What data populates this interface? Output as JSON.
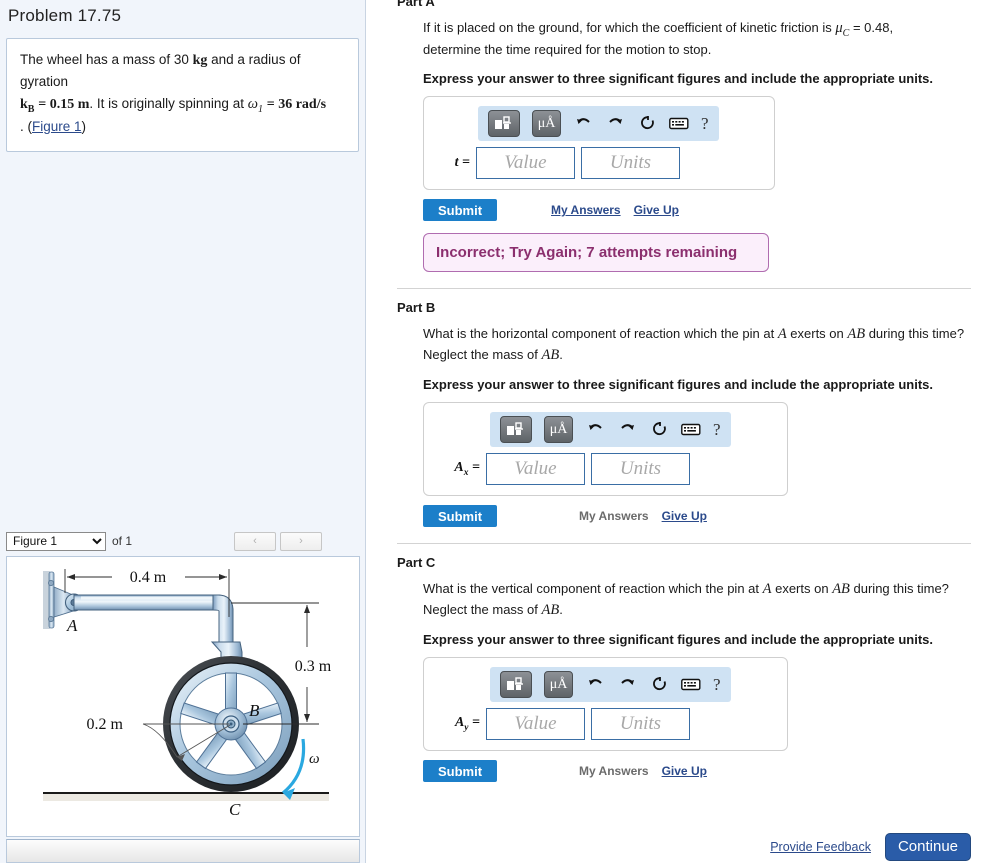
{
  "problem": {
    "title": "Problem 17.75",
    "statement_part1": "The wheel has a mass of 30 ",
    "mass_unit": "kg",
    "statement_part2": " and a radius of gyration",
    "kb_expr": "k",
    "kb_sub": "B",
    "kb_value": "= 0.15 m",
    "statement_part3": ". It is originally spinning at ",
    "omega_sym": "ω",
    "omega_sub": "1",
    "omega_value": "= 36 rad/s",
    "statement_part4": ".",
    "figure_link": "Figure 1"
  },
  "figure_nav": {
    "selected": "Figure 1",
    "options": [
      "Figure 1"
    ],
    "of_label": "of 1",
    "prev_glyph": "‹",
    "next_glyph": "›"
  },
  "figure": {
    "label_a": "A",
    "label_b": "B",
    "label_c": "C",
    "label_omega": "ω",
    "dim_horizontal": "0.4 m",
    "dim_vertical": "0.3 m",
    "dim_radius": "0.2 m"
  },
  "toolbar": {
    "template_icon": "math-template-icon",
    "units_label": "μÅ",
    "undo_icon": "undo-icon",
    "redo_icon": "redo-icon",
    "reset_icon": "reset-icon",
    "keyboard_icon": "keyboard-icon",
    "help_label": "?"
  },
  "inputs": {
    "value_placeholder": "Value",
    "units_placeholder": "Units"
  },
  "parts": [
    {
      "id": "a",
      "header": "Part A",
      "question_html": "If it is placed on the ground, for which the coefficient of kinetic friction is μ_C = 0.48, determine the time required for the motion to stop.",
      "question_pre": "If it is placed on the ground, for which the coefficient of kinetic friction is ",
      "mu_sym": "μ",
      "mu_sub": "C",
      "mu_value": "= 0.48,",
      "question_post": "determine the time required for the motion to stop.",
      "instruction": "Express your answer to three significant figures and include the appropriate units.",
      "var_label": "t",
      "var_sub": "",
      "submit_label": "Submit",
      "my_answers_label": "My Answers",
      "give_up_label": "Give Up",
      "my_answers_active": true,
      "feedback": "Incorrect; Try Again; 7 attempts remaining"
    },
    {
      "id": "b",
      "header": "Part B",
      "question_pre": "What is the horizontal component of reaction which the pin at ",
      "sym_a": "A",
      "question_mid": " exerts on ",
      "sym_ab": "AB",
      "question_post": " during this time? Neglect the mass of ",
      "question_end": ".",
      "instruction": "Express your answer to three significant figures and include the appropriate units.",
      "var_label": "A",
      "var_sub": "x",
      "submit_label": "Submit",
      "my_answers_label": "My Answers",
      "give_up_label": "Give Up",
      "my_answers_active": false,
      "feedback": ""
    },
    {
      "id": "c",
      "header": "Part C",
      "question_pre": "What is the vertical component of reaction which the pin at ",
      "sym_a": "A",
      "question_mid": " exerts on ",
      "sym_ab": "AB",
      "question_post": " during this time? Neglect the mass of ",
      "question_end": ".",
      "instruction": "Express your answer to three significant figures and include the appropriate units.",
      "var_label": "A",
      "var_sub": "y",
      "submit_label": "Submit",
      "my_answers_label": "My Answers",
      "give_up_label": "Give Up",
      "my_answers_active": false,
      "feedback": ""
    }
  ],
  "footer": {
    "provide_feedback_label": "Provide Feedback",
    "continue_label": "Continue"
  },
  "colors": {
    "submit_blue": "#1c7fc9",
    "continue_blue": "#2a5ca8",
    "link_blue": "#2b4a8b",
    "toolbar_blue": "#cfe2f3",
    "feedback_bg": "#fbeffb",
    "feedback_border": "#b06cb0",
    "feedback_text": "#8b2f6e",
    "panel_bg": "#f1f5fb"
  }
}
